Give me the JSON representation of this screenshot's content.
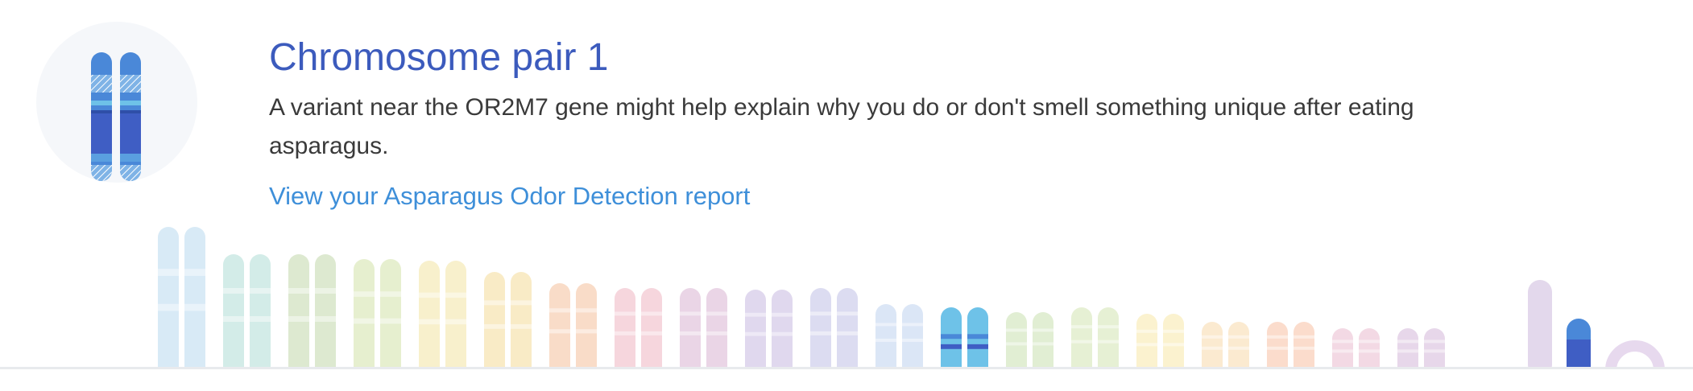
{
  "header": {
    "title": "Chromosome pair 1",
    "description": "A variant near the OR2M7 gene might help explain why you do or don't smell something unique after eating asparagus.",
    "link_label": "View your Asparagus Odor Detection report"
  },
  "icon": {
    "name": "chromosome-pair-icon"
  },
  "chromosome_strip": {
    "highlighted_pair": "1",
    "colors": {
      "highlight_dark": "#3f5ec4",
      "highlight_mid": "#4a88d8",
      "highlight_light": "#6ec2e8",
      "pale": [
        "#d8eaf6",
        "#d3ece8",
        "#dde9d0",
        "#e6efcf",
        "#f8f0cc",
        "#f9ebc6",
        "#f9dcc8",
        "#f6d6dd",
        "#ead5e6",
        "#e0d8ee",
        "#dcdcf1",
        "#dbe6f6",
        "#d6eef1",
        "#e1eed3",
        "#e6f0d4",
        "#fbf2cf",
        "#fbead0",
        "#fbdccc",
        "#f3d9e4",
        "#e7d7ea"
      ]
    }
  }
}
